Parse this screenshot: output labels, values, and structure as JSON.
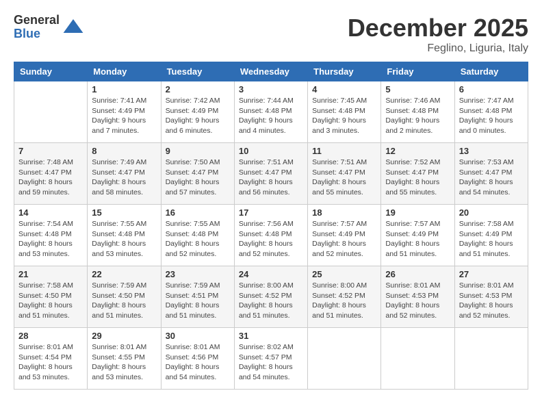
{
  "header": {
    "logo_general": "General",
    "logo_blue": "Blue",
    "month_title": "December 2025",
    "location": "Feglino, Liguria, Italy"
  },
  "weekdays": [
    "Sunday",
    "Monday",
    "Tuesday",
    "Wednesday",
    "Thursday",
    "Friday",
    "Saturday"
  ],
  "weeks": [
    [
      {
        "day": "",
        "sunrise": "",
        "sunset": "",
        "daylight": ""
      },
      {
        "day": "1",
        "sunrise": "Sunrise: 7:41 AM",
        "sunset": "Sunset: 4:49 PM",
        "daylight": "Daylight: 9 hours and 7 minutes."
      },
      {
        "day": "2",
        "sunrise": "Sunrise: 7:42 AM",
        "sunset": "Sunset: 4:49 PM",
        "daylight": "Daylight: 9 hours and 6 minutes."
      },
      {
        "day": "3",
        "sunrise": "Sunrise: 7:44 AM",
        "sunset": "Sunset: 4:48 PM",
        "daylight": "Daylight: 9 hours and 4 minutes."
      },
      {
        "day": "4",
        "sunrise": "Sunrise: 7:45 AM",
        "sunset": "Sunset: 4:48 PM",
        "daylight": "Daylight: 9 hours and 3 minutes."
      },
      {
        "day": "5",
        "sunrise": "Sunrise: 7:46 AM",
        "sunset": "Sunset: 4:48 PM",
        "daylight": "Daylight: 9 hours and 2 minutes."
      },
      {
        "day": "6",
        "sunrise": "Sunrise: 7:47 AM",
        "sunset": "Sunset: 4:48 PM",
        "daylight": "Daylight: 9 hours and 0 minutes."
      }
    ],
    [
      {
        "day": "7",
        "sunrise": "Sunrise: 7:48 AM",
        "sunset": "Sunset: 4:47 PM",
        "daylight": "Daylight: 8 hours and 59 minutes."
      },
      {
        "day": "8",
        "sunrise": "Sunrise: 7:49 AM",
        "sunset": "Sunset: 4:47 PM",
        "daylight": "Daylight: 8 hours and 58 minutes."
      },
      {
        "day": "9",
        "sunrise": "Sunrise: 7:50 AM",
        "sunset": "Sunset: 4:47 PM",
        "daylight": "Daylight: 8 hours and 57 minutes."
      },
      {
        "day": "10",
        "sunrise": "Sunrise: 7:51 AM",
        "sunset": "Sunset: 4:47 PM",
        "daylight": "Daylight: 8 hours and 56 minutes."
      },
      {
        "day": "11",
        "sunrise": "Sunrise: 7:51 AM",
        "sunset": "Sunset: 4:47 PM",
        "daylight": "Daylight: 8 hours and 55 minutes."
      },
      {
        "day": "12",
        "sunrise": "Sunrise: 7:52 AM",
        "sunset": "Sunset: 4:47 PM",
        "daylight": "Daylight: 8 hours and 55 minutes."
      },
      {
        "day": "13",
        "sunrise": "Sunrise: 7:53 AM",
        "sunset": "Sunset: 4:47 PM",
        "daylight": "Daylight: 8 hours and 54 minutes."
      }
    ],
    [
      {
        "day": "14",
        "sunrise": "Sunrise: 7:54 AM",
        "sunset": "Sunset: 4:48 PM",
        "daylight": "Daylight: 8 hours and 53 minutes."
      },
      {
        "day": "15",
        "sunrise": "Sunrise: 7:55 AM",
        "sunset": "Sunset: 4:48 PM",
        "daylight": "Daylight: 8 hours and 53 minutes."
      },
      {
        "day": "16",
        "sunrise": "Sunrise: 7:55 AM",
        "sunset": "Sunset: 4:48 PM",
        "daylight": "Daylight: 8 hours and 52 minutes."
      },
      {
        "day": "17",
        "sunrise": "Sunrise: 7:56 AM",
        "sunset": "Sunset: 4:48 PM",
        "daylight": "Daylight: 8 hours and 52 minutes."
      },
      {
        "day": "18",
        "sunrise": "Sunrise: 7:57 AM",
        "sunset": "Sunset: 4:49 PM",
        "daylight": "Daylight: 8 hours and 52 minutes."
      },
      {
        "day": "19",
        "sunrise": "Sunrise: 7:57 AM",
        "sunset": "Sunset: 4:49 PM",
        "daylight": "Daylight: 8 hours and 51 minutes."
      },
      {
        "day": "20",
        "sunrise": "Sunrise: 7:58 AM",
        "sunset": "Sunset: 4:49 PM",
        "daylight": "Daylight: 8 hours and 51 minutes."
      }
    ],
    [
      {
        "day": "21",
        "sunrise": "Sunrise: 7:58 AM",
        "sunset": "Sunset: 4:50 PM",
        "daylight": "Daylight: 8 hours and 51 minutes."
      },
      {
        "day": "22",
        "sunrise": "Sunrise: 7:59 AM",
        "sunset": "Sunset: 4:50 PM",
        "daylight": "Daylight: 8 hours and 51 minutes."
      },
      {
        "day": "23",
        "sunrise": "Sunrise: 7:59 AM",
        "sunset": "Sunset: 4:51 PM",
        "daylight": "Daylight: 8 hours and 51 minutes."
      },
      {
        "day": "24",
        "sunrise": "Sunrise: 8:00 AM",
        "sunset": "Sunset: 4:52 PM",
        "daylight": "Daylight: 8 hours and 51 minutes."
      },
      {
        "day": "25",
        "sunrise": "Sunrise: 8:00 AM",
        "sunset": "Sunset: 4:52 PM",
        "daylight": "Daylight: 8 hours and 51 minutes."
      },
      {
        "day": "26",
        "sunrise": "Sunrise: 8:01 AM",
        "sunset": "Sunset: 4:53 PM",
        "daylight": "Daylight: 8 hours and 52 minutes."
      },
      {
        "day": "27",
        "sunrise": "Sunrise: 8:01 AM",
        "sunset": "Sunset: 4:53 PM",
        "daylight": "Daylight: 8 hours and 52 minutes."
      }
    ],
    [
      {
        "day": "28",
        "sunrise": "Sunrise: 8:01 AM",
        "sunset": "Sunset: 4:54 PM",
        "daylight": "Daylight: 8 hours and 53 minutes."
      },
      {
        "day": "29",
        "sunrise": "Sunrise: 8:01 AM",
        "sunset": "Sunset: 4:55 PM",
        "daylight": "Daylight: 8 hours and 53 minutes."
      },
      {
        "day": "30",
        "sunrise": "Sunrise: 8:01 AM",
        "sunset": "Sunset: 4:56 PM",
        "daylight": "Daylight: 8 hours and 54 minutes."
      },
      {
        "day": "31",
        "sunrise": "Sunrise: 8:02 AM",
        "sunset": "Sunset: 4:57 PM",
        "daylight": "Daylight: 8 hours and 54 minutes."
      },
      {
        "day": "",
        "sunrise": "",
        "sunset": "",
        "daylight": ""
      },
      {
        "day": "",
        "sunrise": "",
        "sunset": "",
        "daylight": ""
      },
      {
        "day": "",
        "sunrise": "",
        "sunset": "",
        "daylight": ""
      }
    ]
  ]
}
